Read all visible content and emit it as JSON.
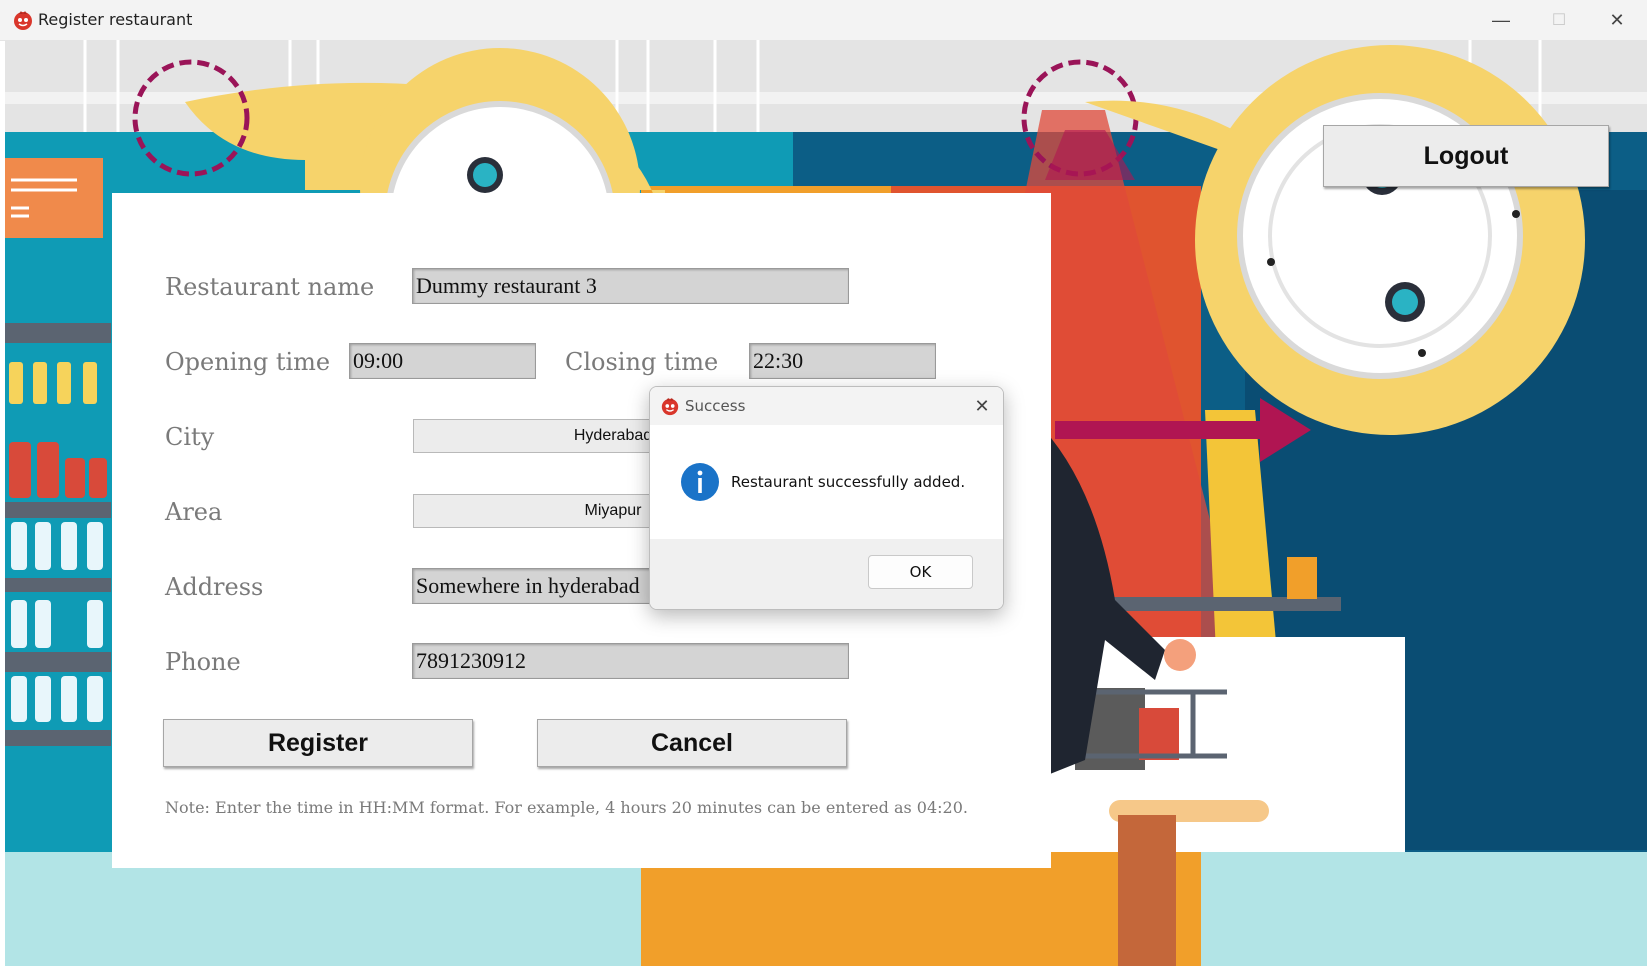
{
  "window": {
    "title": "Register restaurant",
    "app_icon": "pomegranate-app-icon",
    "controls": {
      "minimize": "—",
      "maximize": "☐",
      "close": "✕"
    }
  },
  "header": {
    "logout_label": "Logout"
  },
  "form": {
    "restaurant_name_label": "Restaurant name",
    "restaurant_name_value": "Dummy restaurant 3",
    "opening_time_label": "Opening time",
    "opening_time_value": "09:00",
    "closing_time_label": "Closing time",
    "closing_time_value": "22:30",
    "city_label": "City",
    "city_value": "Hyderabad",
    "area_label": "Area",
    "area_value": "Miyapur",
    "address_label": "Address",
    "address_value": "Somewhere in hyderabad",
    "phone_label": "Phone",
    "phone_value": "7891230912",
    "register_label": "Register",
    "cancel_label": "Cancel",
    "note": "Note: Enter the time in HH:MM format. For example, 4 hours 20 minutes can be entered as 04:20."
  },
  "dialog": {
    "title": "Success",
    "icon": "info-icon",
    "message": "Restaurant successfully added.",
    "ok_label": "OK",
    "close": "✕"
  }
}
